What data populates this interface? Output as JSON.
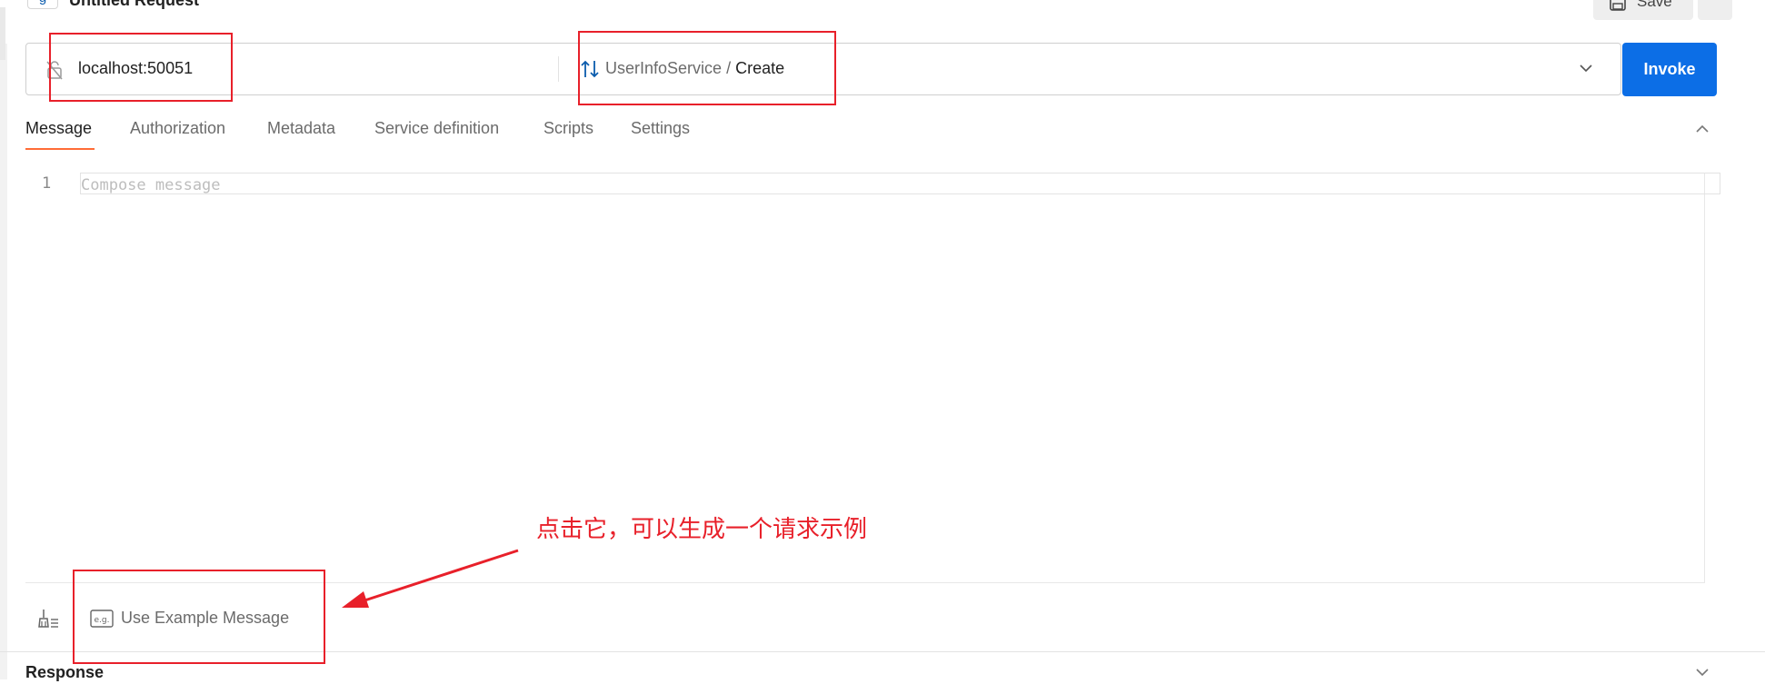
{
  "request": {
    "icon_label": "g",
    "title": "Untitled Request",
    "save_label": "Save"
  },
  "urlbar": {
    "host": "localhost:50051",
    "service": "UserInfoService",
    "separator": " / ",
    "method": "Create",
    "invoke_label": "Invoke"
  },
  "tabs": [
    {
      "label": "Message",
      "active": true
    },
    {
      "label": "Authorization"
    },
    {
      "label": "Metadata"
    },
    {
      "label": "Service definition"
    },
    {
      "label": "Scripts"
    },
    {
      "label": "Settings"
    }
  ],
  "editor": {
    "line_number": "1",
    "placeholder": "Compose message"
  },
  "toolbar": {
    "example_label": "Use Example Message"
  },
  "response": {
    "label": "Response"
  },
  "annotation": {
    "text": "点击它，可以生成一个请求示例",
    "color": "#e8202a"
  },
  "colors": {
    "accent": "#0c6ee6",
    "tab_underline": "#ff6c37"
  },
  "icons": [
    "lock-off-icon",
    "grpc-method-icon",
    "chevron-down-icon",
    "chevron-up-icon",
    "save-icon",
    "broom-icon",
    "example-icon"
  ]
}
